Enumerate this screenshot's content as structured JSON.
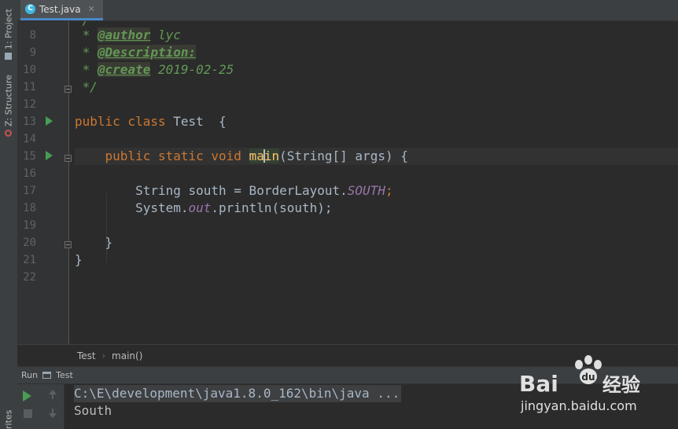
{
  "tool_strip": {
    "project_label": "1: Project",
    "structure_label": "Z: Structure",
    "favorites_label": "rites"
  },
  "editor_tab": {
    "label": "Test.java",
    "icon": "java-class-icon",
    "icon_letter": "C"
  },
  "editor": {
    "line_numbers": [
      "8",
      "9",
      "10",
      "11",
      "12",
      "13",
      "14",
      "15",
      "16",
      "17",
      "18",
      "19",
      "20",
      "21",
      "22"
    ],
    "run_gutter_lines": [
      "13",
      "15"
    ]
  },
  "code": {
    "l8": {
      "star": " * ",
      "tag": "@author",
      "text": " lyc"
    },
    "l9": {
      "star": " * ",
      "tag": "@Description:"
    },
    "l10": {
      "star": " * ",
      "tag": "@create",
      "text": " 2019-02-25"
    },
    "l11": {
      "text": " */"
    },
    "l13": {
      "kw": "public class",
      "rest": " Test  {"
    },
    "l15": {
      "kw": "    public static void",
      "pre": " ",
      "main_a": "ma",
      "main_b": "in",
      "rest": "(String[] args) {"
    },
    "l17": {
      "pre": "        String south = BorderLayout.",
      "field": "SOUTH",
      "post": ";"
    },
    "l18": {
      "pre": "        System.",
      "field": "out",
      "post": ".println(south);"
    },
    "l20": {
      "text": "    }"
    },
    "l21": {
      "text": "}"
    }
  },
  "breadcrumb": {
    "class_name": "Test",
    "method_name": "main()"
  },
  "run_panel": {
    "title": "Run",
    "config_name": "Test",
    "command": "C:\\E\\development\\java1.8.0_162\\bin\\java ...",
    "output": "South"
  },
  "watermark": {
    "logo_text": "Bai  du",
    "suffix": "经验",
    "url": "jingyan.baidu.com"
  },
  "colors": {
    "background": "#2b2b2b",
    "keyword": "#cc7832",
    "doc_comment": "#629755",
    "static_field": "#9876aa",
    "method_highlight": "#ffc66d",
    "run_green": "#499c54"
  }
}
